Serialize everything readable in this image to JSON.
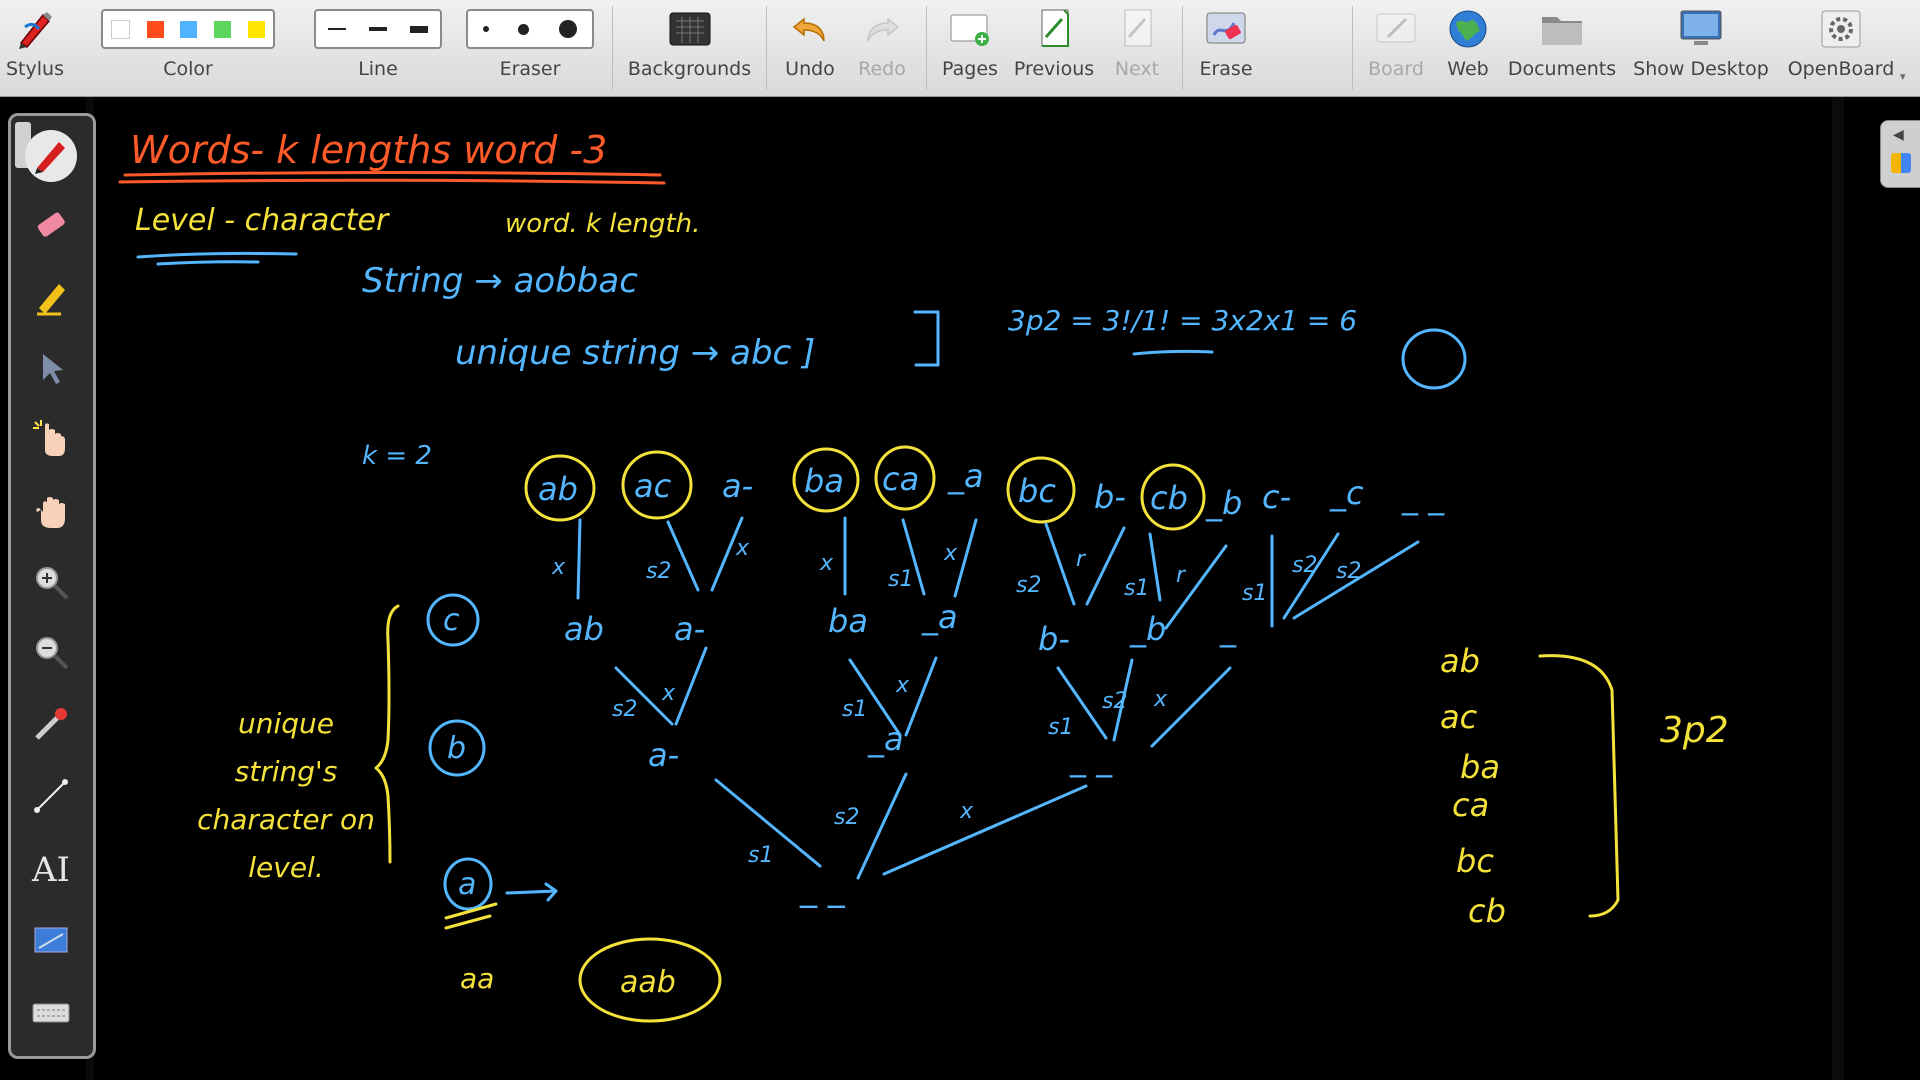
{
  "toolbar": {
    "stylus": "Stylus",
    "color": "Color",
    "line": "Line",
    "eraser": "Eraser",
    "backgrounds": "Backgrounds",
    "undo": "Undo",
    "redo": "Redo",
    "pages": "Pages",
    "previous": "Previous",
    "next": "Next",
    "erase": "Erase",
    "board": "Board",
    "web": "Web",
    "documents": "Documents",
    "show_desktop": "Show Desktop",
    "openboard": "OpenBoard",
    "colors": [
      "#ffffff",
      "#ff4a1c",
      "#4fb3ff",
      "#5cd65c",
      "#ffe600"
    ]
  },
  "side_tools": [
    "pen-icon",
    "eraser-icon",
    "marker-icon",
    "selector-icon",
    "interactor-hand-icon",
    "hand-icon",
    "zoom-in-icon",
    "zoom-out-icon",
    "laser-pointer-icon",
    "line-icon",
    "text-icon",
    "capture-icon",
    "keyboard-icon"
  ],
  "board": {
    "title": "Words- k lengths word -3",
    "level": "Level - character",
    "wordklength": "word. k length.",
    "string_line": "String →   aobbac",
    "unique_line": "unique string →   abc ]",
    "perm_expr": "3p2 = 3!/1! = 3x2x1 = 6",
    "k_eq": "k = 2",
    "top_row": [
      "ab",
      "ac",
      "a-",
      "ba",
      "ca",
      "_a",
      "bc",
      "b-",
      "cb",
      "_b",
      "c-",
      "_c",
      "_ _"
    ],
    "mid_row": [
      "ab",
      "a-",
      "ba",
      "_a",
      "b-",
      "_b",
      "_"
    ],
    "low_row": [
      "a-",
      "_a",
      "_ _"
    ],
    "root": "_ _",
    "edge_labels": [
      "x",
      "s2",
      "x",
      "x",
      "s1",
      "x",
      "s2",
      "r",
      "s1",
      "r",
      "s1",
      "s2",
      "s2",
      "s2",
      "x",
      "s1",
      "x",
      "s1",
      "s2",
      "x",
      "s1",
      "s2",
      "x"
    ],
    "left_circles": [
      "c",
      "b",
      "a"
    ],
    "unique_note": "unique string's character on level.",
    "aa": "aa",
    "aab": "aab",
    "list": [
      "ab",
      "ac",
      "ba",
      "ca",
      "bc",
      "cb"
    ],
    "list_label": "3p2"
  }
}
